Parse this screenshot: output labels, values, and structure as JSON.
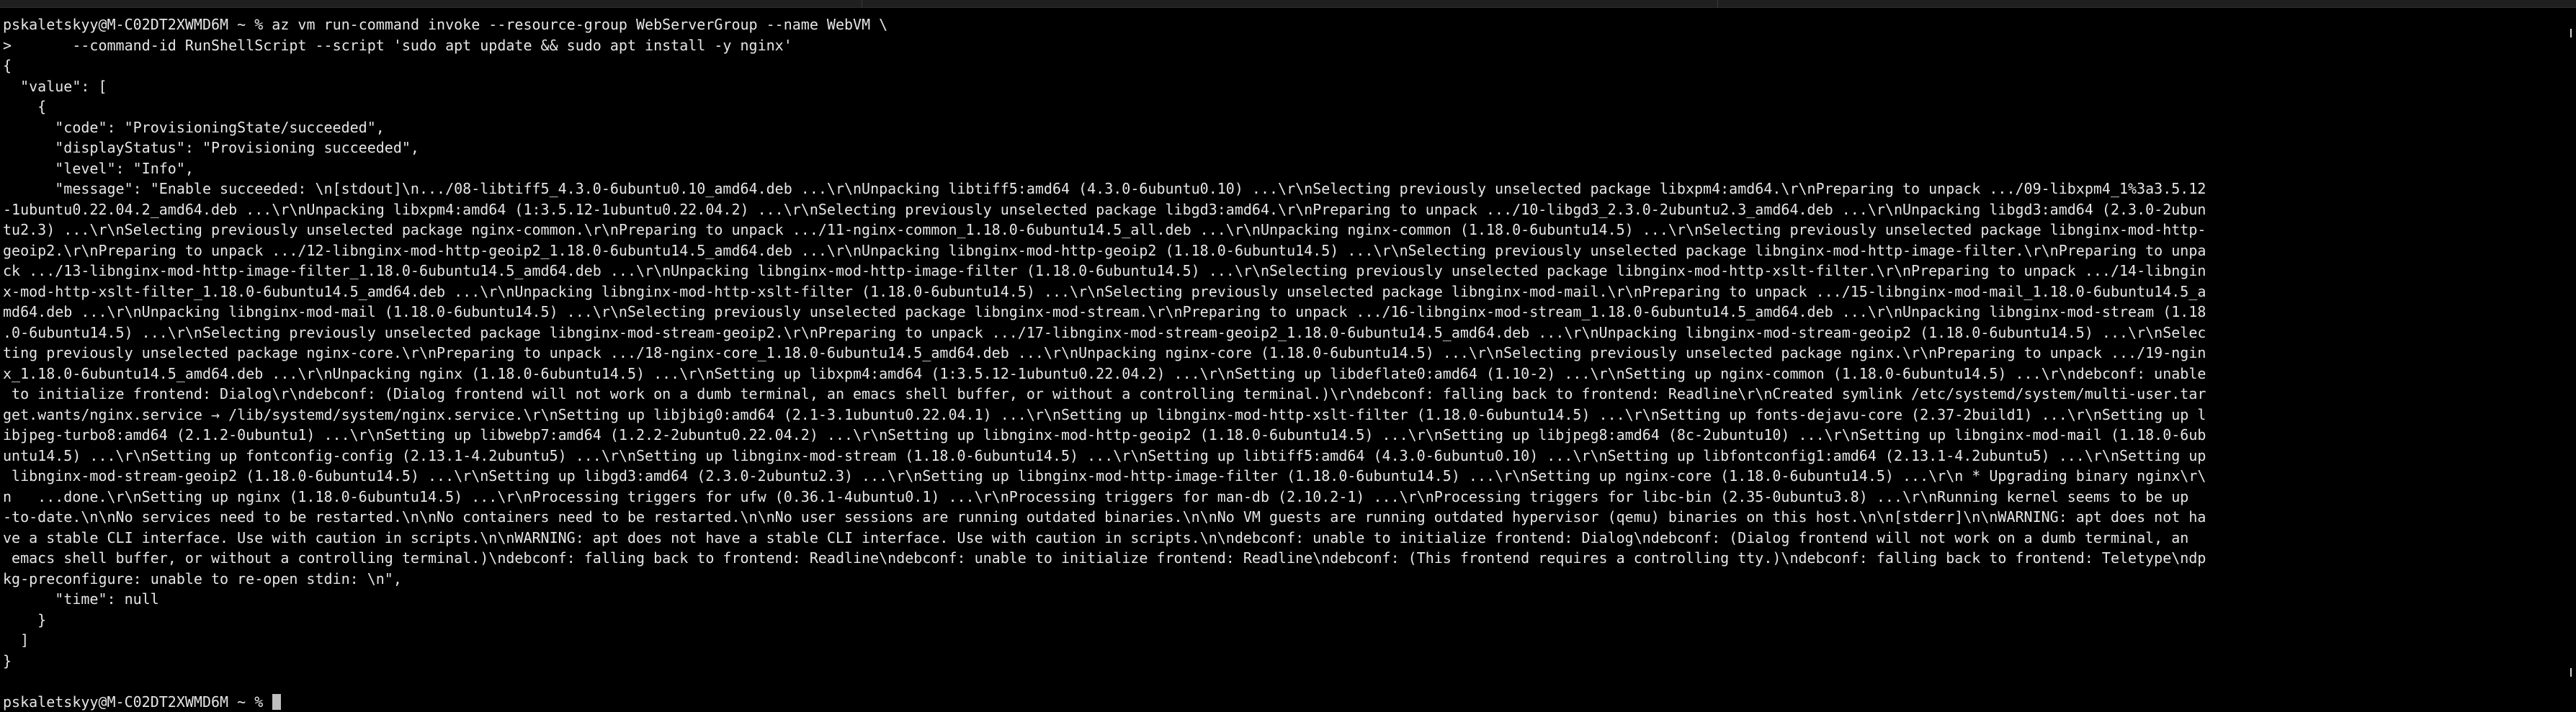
{
  "terminal": {
    "prompt": "pskaletskyy@M-C02DT2XWMD6M ~ % ",
    "command_line_1": "az vm run-command invoke --resource-group WebServerGroup --name WebVM \\",
    "continuation_marker": ">",
    "command_line_2": "       --command-id RunShellScript --script 'sudo apt update && sudo apt install -y nginx'",
    "output_lines": [
      "{",
      "  \"value\": [",
      "    {",
      "      \"code\": \"ProvisioningState/succeeded\",",
      "      \"displayStatus\": \"Provisioning succeeded\",",
      "      \"level\": \"Info\",",
      "      \"message\": \"Enable succeeded: \\n[stdout]\\n.../08-libtiff5_4.3.0-6ubuntu0.10_amd64.deb ...\\r\\nUnpacking libtiff5:amd64 (4.3.0-6ubuntu0.10) ...\\r\\nSelecting previously unselected package libxpm4:amd64.\\r\\nPreparing to unpack .../09-libxpm4_1%3a3.5.12",
      "-1ubuntu0.22.04.2_amd64.deb ...\\r\\nUnpacking libxpm4:amd64 (1:3.5.12-1ubuntu0.22.04.2) ...\\r\\nSelecting previously unselected package libgd3:amd64.\\r\\nPreparing to unpack .../10-libgd3_2.3.0-2ubuntu2.3_amd64.deb ...\\r\\nUnpacking libgd3:amd64 (2.3.0-2ubun",
      "tu2.3) ...\\r\\nSelecting previously unselected package nginx-common.\\r\\nPreparing to unpack .../11-nginx-common_1.18.0-6ubuntu14.5_all.deb ...\\r\\nUnpacking nginx-common (1.18.0-6ubuntu14.5) ...\\r\\nSelecting previously unselected package libnginx-mod-http-",
      "geoip2.\\r\\nPreparing to unpack .../12-libnginx-mod-http-geoip2_1.18.0-6ubuntu14.5_amd64.deb ...\\r\\nUnpacking libnginx-mod-http-geoip2 (1.18.0-6ubuntu14.5) ...\\r\\nSelecting previously unselected package libnginx-mod-http-image-filter.\\r\\nPreparing to unpa",
      "ck .../13-libnginx-mod-http-image-filter_1.18.0-6ubuntu14.5_amd64.deb ...\\r\\nUnpacking libnginx-mod-http-image-filter (1.18.0-6ubuntu14.5) ...\\r\\nSelecting previously unselected package libnginx-mod-http-xslt-filter.\\r\\nPreparing to unpack .../14-libngin",
      "x-mod-http-xslt-filter_1.18.0-6ubuntu14.5_amd64.deb ...\\r\\nUnpacking libnginx-mod-http-xslt-filter (1.18.0-6ubuntu14.5) ...\\r\\nSelecting previously unselected package libnginx-mod-mail.\\r\\nPreparing to unpack .../15-libnginx-mod-mail_1.18.0-6ubuntu14.5_a",
      "md64.deb ...\\r\\nUnpacking libnginx-mod-mail (1.18.0-6ubuntu14.5) ...\\r\\nSelecting previously unselected package libnginx-mod-stream.\\r\\nPreparing to unpack .../16-libnginx-mod-stream_1.18.0-6ubuntu14.5_amd64.deb ...\\r\\nUnpacking libnginx-mod-stream (1.18",
      ".0-6ubuntu14.5) ...\\r\\nSelecting previously unselected package libnginx-mod-stream-geoip2.\\r\\nPreparing to unpack .../17-libnginx-mod-stream-geoip2_1.18.0-6ubuntu14.5_amd64.deb ...\\r\\nUnpacking libnginx-mod-stream-geoip2 (1.18.0-6ubuntu14.5) ...\\r\\nSelec",
      "ting previously unselected package nginx-core.\\r\\nPreparing to unpack .../18-nginx-core_1.18.0-6ubuntu14.5_amd64.deb ...\\r\\nUnpacking nginx-core (1.18.0-6ubuntu14.5) ...\\r\\nSelecting previously unselected package nginx.\\r\\nPreparing to unpack .../19-ngin",
      "x_1.18.0-6ubuntu14.5_amd64.deb ...\\r\\nUnpacking nginx (1.18.0-6ubuntu14.5) ...\\r\\nSetting up libxpm4:amd64 (1:3.5.12-1ubuntu0.22.04.2) ...\\r\\nSetting up libdeflate0:amd64 (1.10-2) ...\\r\\nSetting up nginx-common (1.18.0-6ubuntu14.5) ...\\r\\ndebconf: unable",
      " to initialize frontend: Dialog\\r\\ndebconf: (Dialog frontend will not work on a dumb terminal, an emacs shell buffer, or without a controlling terminal.)\\r\\ndebconf: falling back to frontend: Readline\\r\\nCreated symlink /etc/systemd/system/multi-user.tar",
      "get.wants/nginx.service → /lib/systemd/system/nginx.service.\\r\\nSetting up libjbig0:amd64 (2.1-3.1ubuntu0.22.04.1) ...\\r\\nSetting up libnginx-mod-http-xslt-filter (1.18.0-6ubuntu14.5) ...\\r\\nSetting up fonts-dejavu-core (2.37-2build1) ...\\r\\nSetting up l",
      "ibjpeg-turbo8:amd64 (2.1.2-0ubuntu1) ...\\r\\nSetting up libwebp7:amd64 (1.2.2-2ubuntu0.22.04.2) ...\\r\\nSetting up libnginx-mod-http-geoip2 (1.18.0-6ubuntu14.5) ...\\r\\nSetting up libjpeg8:amd64 (8c-2ubuntu10) ...\\r\\nSetting up libnginx-mod-mail (1.18.0-6ub",
      "untu14.5) ...\\r\\nSetting up fontconfig-config (2.13.1-4.2ubuntu5) ...\\r\\nSetting up libnginx-mod-stream (1.18.0-6ubuntu14.5) ...\\r\\nSetting up libtiff5:amd64 (4.3.0-6ubuntu0.10) ...\\r\\nSetting up libfontconfig1:amd64 (2.13.1-4.2ubuntu5) ...\\r\\nSetting up",
      " libnginx-mod-stream-geoip2 (1.18.0-6ubuntu14.5) ...\\r\\nSetting up libgd3:amd64 (2.3.0-2ubuntu2.3) ...\\r\\nSetting up libnginx-mod-http-image-filter (1.18.0-6ubuntu14.5) ...\\r\\nSetting up nginx-core (1.18.0-6ubuntu14.5) ...\\r\\n * Upgrading binary nginx\\r\\",
      "n   ...done.\\r\\nSetting up nginx (1.18.0-6ubuntu14.5) ...\\r\\nProcessing triggers for ufw (0.36.1-4ubuntu0.1) ...\\r\\nProcessing triggers for man-db (2.10.2-1) ...\\r\\nProcessing triggers for libc-bin (2.35-0ubuntu3.8) ...\\r\\nRunning kernel seems to be up",
      "-to-date.\\n\\nNo services need to be restarted.\\n\\nNo containers need to be restarted.\\n\\nNo user sessions are running outdated binaries.\\n\\nNo VM guests are running outdated hypervisor (qemu) binaries on this host.\\n\\n[stderr]\\n\\nWARNING: apt does not ha",
      "ve a stable CLI interface. Use with caution in scripts.\\n\\nWARNING: apt does not have a stable CLI interface. Use with caution in scripts.\\n\\ndebconf: unable to initialize frontend: Dialog\\ndebconf: (Dialog frontend will not work on a dumb terminal, an",
      " emacs shell buffer, or without a controlling terminal.)\\ndebconf: falling back to frontend: Readline\\ndebconf: unable to initialize frontend: Readline\\ndebconf: (This frontend requires a controlling tty.)\\ndebconf: falling back to frontend: Teletype\\ndp",
      "kg-preconfigure: unable to re-open stdin: \\n\",",
      "      \"time\": null",
      "    }",
      "  ]",
      "}"
    ]
  },
  "colors": {
    "background": "#000000",
    "text": "#e6e6e6",
    "cursor": "#bfbfbf"
  }
}
